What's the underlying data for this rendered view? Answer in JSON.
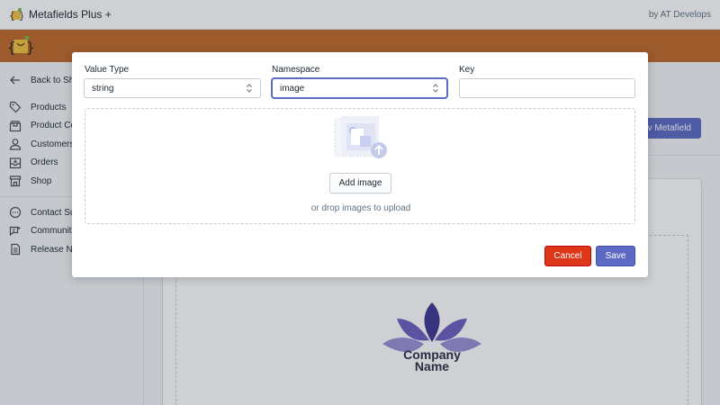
{
  "topbar": {
    "app_title": "Metafields Plus +",
    "by_text": "by AT Develops"
  },
  "colors": {
    "brand_bar": "#c0692a",
    "primary": "#5c6ac4",
    "destructive": "#de3618"
  },
  "sidebar": {
    "back_label": "Back to Sh",
    "items": [
      {
        "label": "Products",
        "icon": "tag-icon"
      },
      {
        "label": "Product Co",
        "icon": "collection-icon"
      },
      {
        "label": "Customers",
        "icon": "customer-icon"
      },
      {
        "label": "Orders",
        "icon": "orders-icon"
      },
      {
        "label": "Shop",
        "icon": "store-icon"
      }
    ],
    "support_items": [
      {
        "label": "Contact Su",
        "icon": "chat-icon"
      },
      {
        "label": "Communit",
        "icon": "community-icon"
      },
      {
        "label": "Release No",
        "icon": "notes-icon"
      }
    ]
  },
  "main": {
    "new_metafield_label": "v Metafield",
    "logo_line1": "Company",
    "logo_line2": "Name"
  },
  "modal": {
    "value_type": {
      "label": "Value Type",
      "selected": "string"
    },
    "namespace": {
      "label": "Namespace",
      "selected": "image"
    },
    "key": {
      "label": "Key",
      "value": ""
    },
    "dropzone": {
      "button_label": "Add image",
      "hint": "or drop images to upload"
    },
    "cancel_label": "Cancel",
    "save_label": "Save"
  }
}
